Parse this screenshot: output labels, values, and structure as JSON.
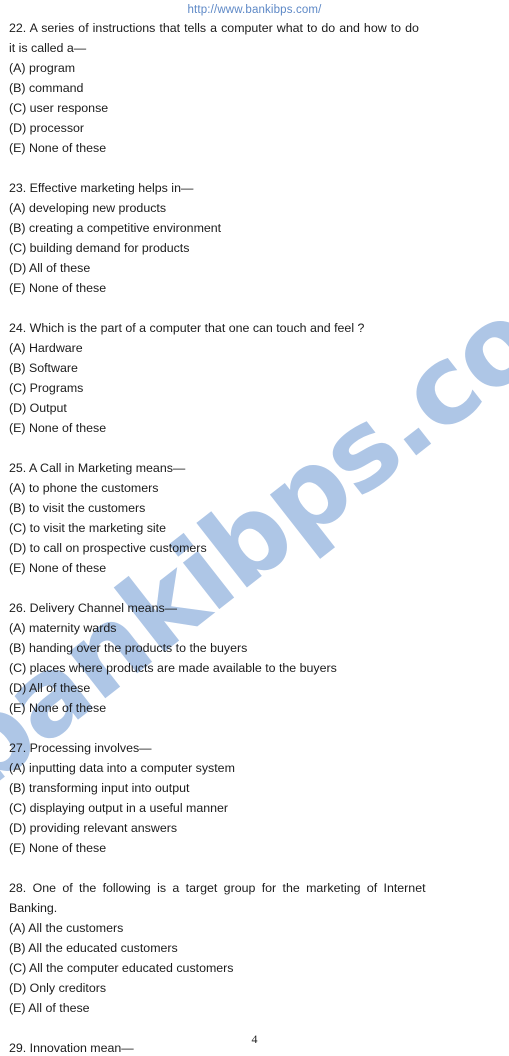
{
  "header": {
    "url": "http://www.bankibps.com/",
    "url_color": "#5d88c6"
  },
  "watermark": {
    "text": "bankibps.com",
    "color": "#aec6e6",
    "rotation_deg": -38
  },
  "footer": {
    "page_number": "4"
  },
  "questions": [
    {
      "number": "22.",
      "stem_lines": [
        "22. A series of instructions that tells a computer what to do and how to do",
        "it is called a—"
      ],
      "stem": "22. A series of instructions that tells a computer what to do and how to do it is called a—",
      "options": [
        "(A) program",
        "(B) command",
        "(C) user response",
        "(D) processor",
        "(E) None of these"
      ]
    },
    {
      "number": "23.",
      "stem_lines": [
        "23. Effective marketing helps in—"
      ],
      "stem": "23. Effective marketing helps in—",
      "options": [
        "(A) developing new products",
        "(B) creating a competitive environment",
        "(C) building demand for products",
        "(D) All of these",
        "(E) None of these"
      ]
    },
    {
      "number": "24.",
      "stem_lines": [
        "24. Which is the part of a computer that one can touch and feel ?"
      ],
      "stem": "24. Which is the part of a computer that one can touch and feel ?",
      "options": [
        "(A) Hardware",
        "(B) Software",
        "(C) Programs",
        "(D) Output",
        "(E) None of these"
      ]
    },
    {
      "number": "25.",
      "stem_lines": [
        "25. A Call in Marketing means—"
      ],
      "stem": "25. A Call in Marketing means—",
      "options": [
        "(A) to phone the customers",
        "(B) to visit the customers",
        "(C) to visit the marketing site",
        "(D) to call on prospective customers",
        "(E) None of these"
      ]
    },
    {
      "number": "26.",
      "stem_lines": [
        "26. Delivery Channel means—"
      ],
      "stem": "26. Delivery Channel means—",
      "options": [
        "(A) maternity wards",
        "(B) handing over the products to the buyers",
        "(C) places where products are made available to the buyers",
        "(D) All of these",
        "(E) None of these"
      ]
    },
    {
      "number": "27.",
      "stem_lines": [
        "27. Processing involves—"
      ],
      "stem": "27. Processing involves—",
      "options": [
        "(A) inputting data into a computer system",
        "(B) transforming input into output",
        "(C) displaying output in a useful manner",
        "(D) providing relevant answers",
        "(E) None of these"
      ]
    },
    {
      "number": "28.",
      "stem_lines": [
        "28. One of the following is a target group for the marketing of Internet",
        "Banking."
      ],
      "stem": "28. One of the following is a target group for the marketing of Internet Banking.",
      "options": [
        "(A) All the customers",
        "(B) All the educated customers",
        "(C) All the computer educated customers",
        "(D) Only creditors",
        "(E) All of these"
      ]
    },
    {
      "number": "29.",
      "stem_lines": [
        "29. Innovation mean—"
      ],
      "stem": "29. Innovation mean—",
      "options": []
    }
  ]
}
